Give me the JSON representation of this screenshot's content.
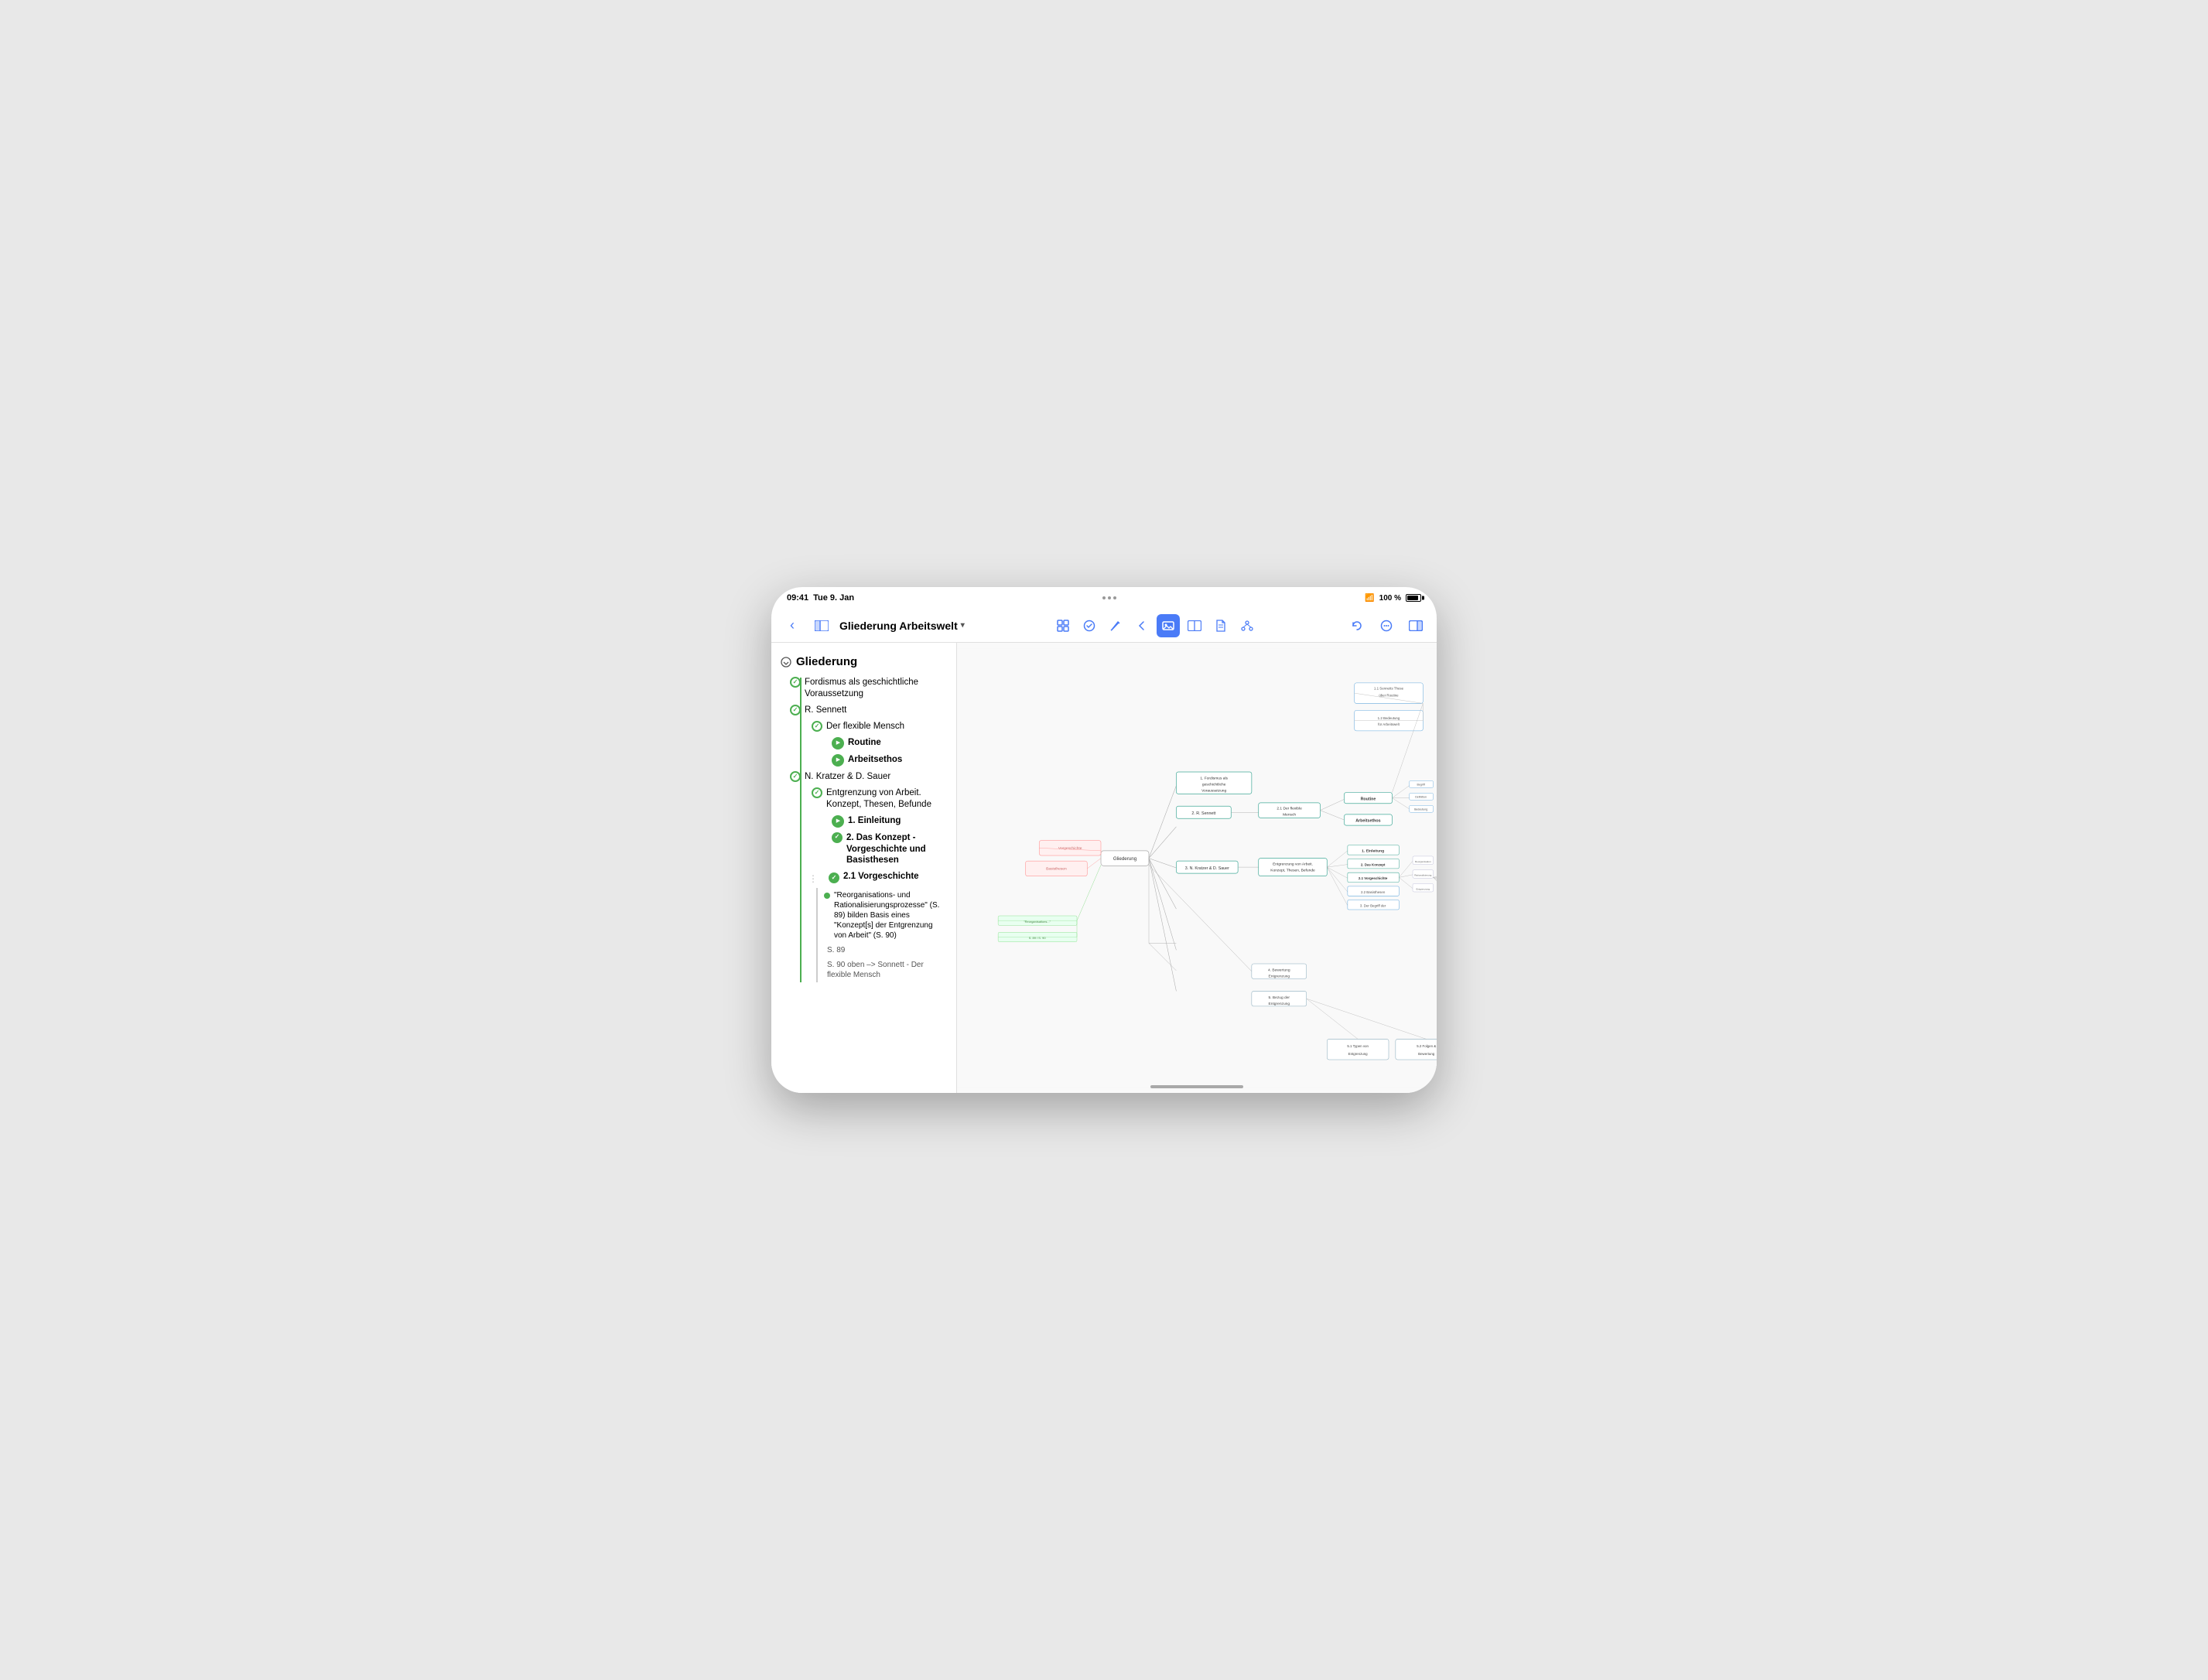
{
  "device": {
    "time": "09:41",
    "date": "Tue 9. Jan",
    "wifi": "WiFi",
    "battery": "100 %"
  },
  "toolbar": {
    "back_label": "‹",
    "sidebar_icon": "sidebar",
    "title": "Gliederung Arbeitswelt",
    "dropdown_icon": "▾",
    "icons": [
      "grid-icon",
      "check-icon",
      "pencil-icon",
      "back-arrow-icon",
      "image-icon",
      "split-view-icon",
      "document-icon",
      "share-icon"
    ],
    "right_icons": [
      "undo-icon",
      "more-icon",
      "sidebar-right-icon"
    ]
  },
  "outline": {
    "header": "Gliederung",
    "items": [
      {
        "id": 1,
        "level": 0,
        "text": "Fordismus als geschichtliche Voraussetzung",
        "icon": "circle-check-outline",
        "bold": false
      },
      {
        "id": 2,
        "level": 1,
        "text": "R. Sennett",
        "icon": "circle-check-outline",
        "bold": false
      },
      {
        "id": 3,
        "level": 2,
        "text": "Der flexible Mensch",
        "icon": "circle-check-outline",
        "bold": false
      },
      {
        "id": 4,
        "level": 3,
        "text": "Routine",
        "icon": "play",
        "bold": true
      },
      {
        "id": 5,
        "level": 3,
        "text": "Arbeitsethos",
        "icon": "play",
        "bold": true
      },
      {
        "id": 6,
        "level": 1,
        "text": "N. Kratzer & D. Sauer",
        "icon": "circle-check-outline",
        "bold": false
      },
      {
        "id": 7,
        "level": 2,
        "text": "Entgrenzung von Arbeit. Konzept, Thesen, Befunde",
        "icon": "circle-check-outline",
        "bold": false
      },
      {
        "id": 8,
        "level": 3,
        "text": "1. Einleitung",
        "icon": "play",
        "bold": true
      },
      {
        "id": 9,
        "level": 3,
        "text": "2. Das Konzept - Vorgeschichte und Basisthesen",
        "icon": "circle-check-filled",
        "bold": true
      },
      {
        "id": 10,
        "level": 3,
        "text": "2.1 Vorgeschichte",
        "icon": "circle-check-filled",
        "bold": true
      },
      {
        "id": 11,
        "level": 4,
        "text": "\"Reorganisations- und Rationalisierungsprozesse\" (S. 89) bilden Basis eines \"Konzept[s] der Entgrenzung von Arbeit\" (S. 90)",
        "icon": "dot",
        "bold": false
      },
      {
        "id": 12,
        "level": 4,
        "text": "S. 89",
        "icon": "none",
        "bold": false
      },
      {
        "id": 13,
        "level": 4,
        "text": "S. 90  oben  –> Sonnett - Der flexible Mensch",
        "icon": "none",
        "bold": false
      }
    ]
  },
  "mindmap": {
    "center_label": "Gliederung",
    "nodes": []
  }
}
